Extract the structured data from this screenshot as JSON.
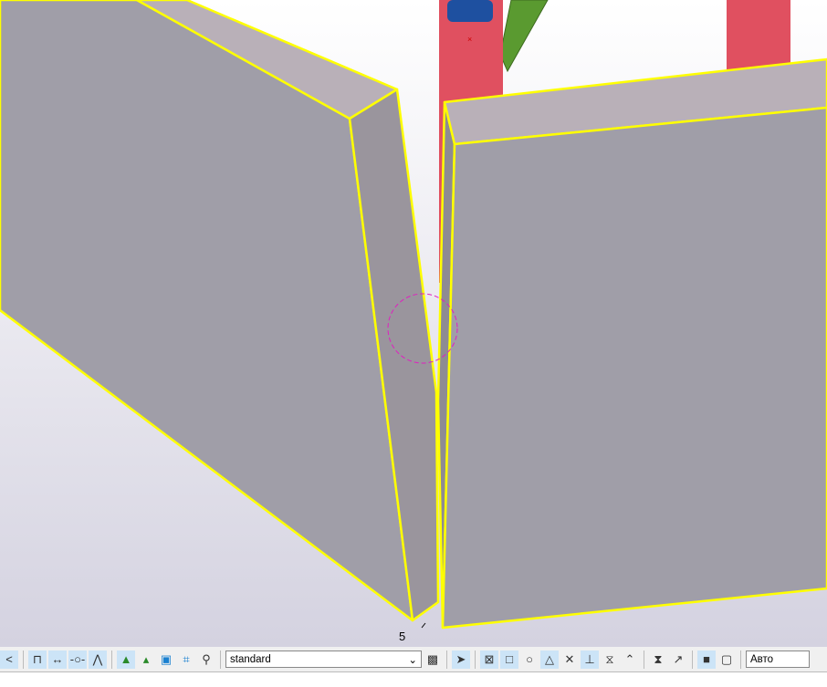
{
  "viewport": {
    "point_label": "5",
    "colors": {
      "panel_front": "#a09ea8",
      "panel_top": "#b9b0b8",
      "panel_side": "#9d989f",
      "outline": "#ffff00",
      "pipe": "#e05060",
      "pipe_inner": "#1e50a0",
      "beam": "#5a9a30",
      "snap": "#e020c0"
    }
  },
  "toolbar": {
    "view_select": "standard",
    "unit_select": "Авто"
  }
}
